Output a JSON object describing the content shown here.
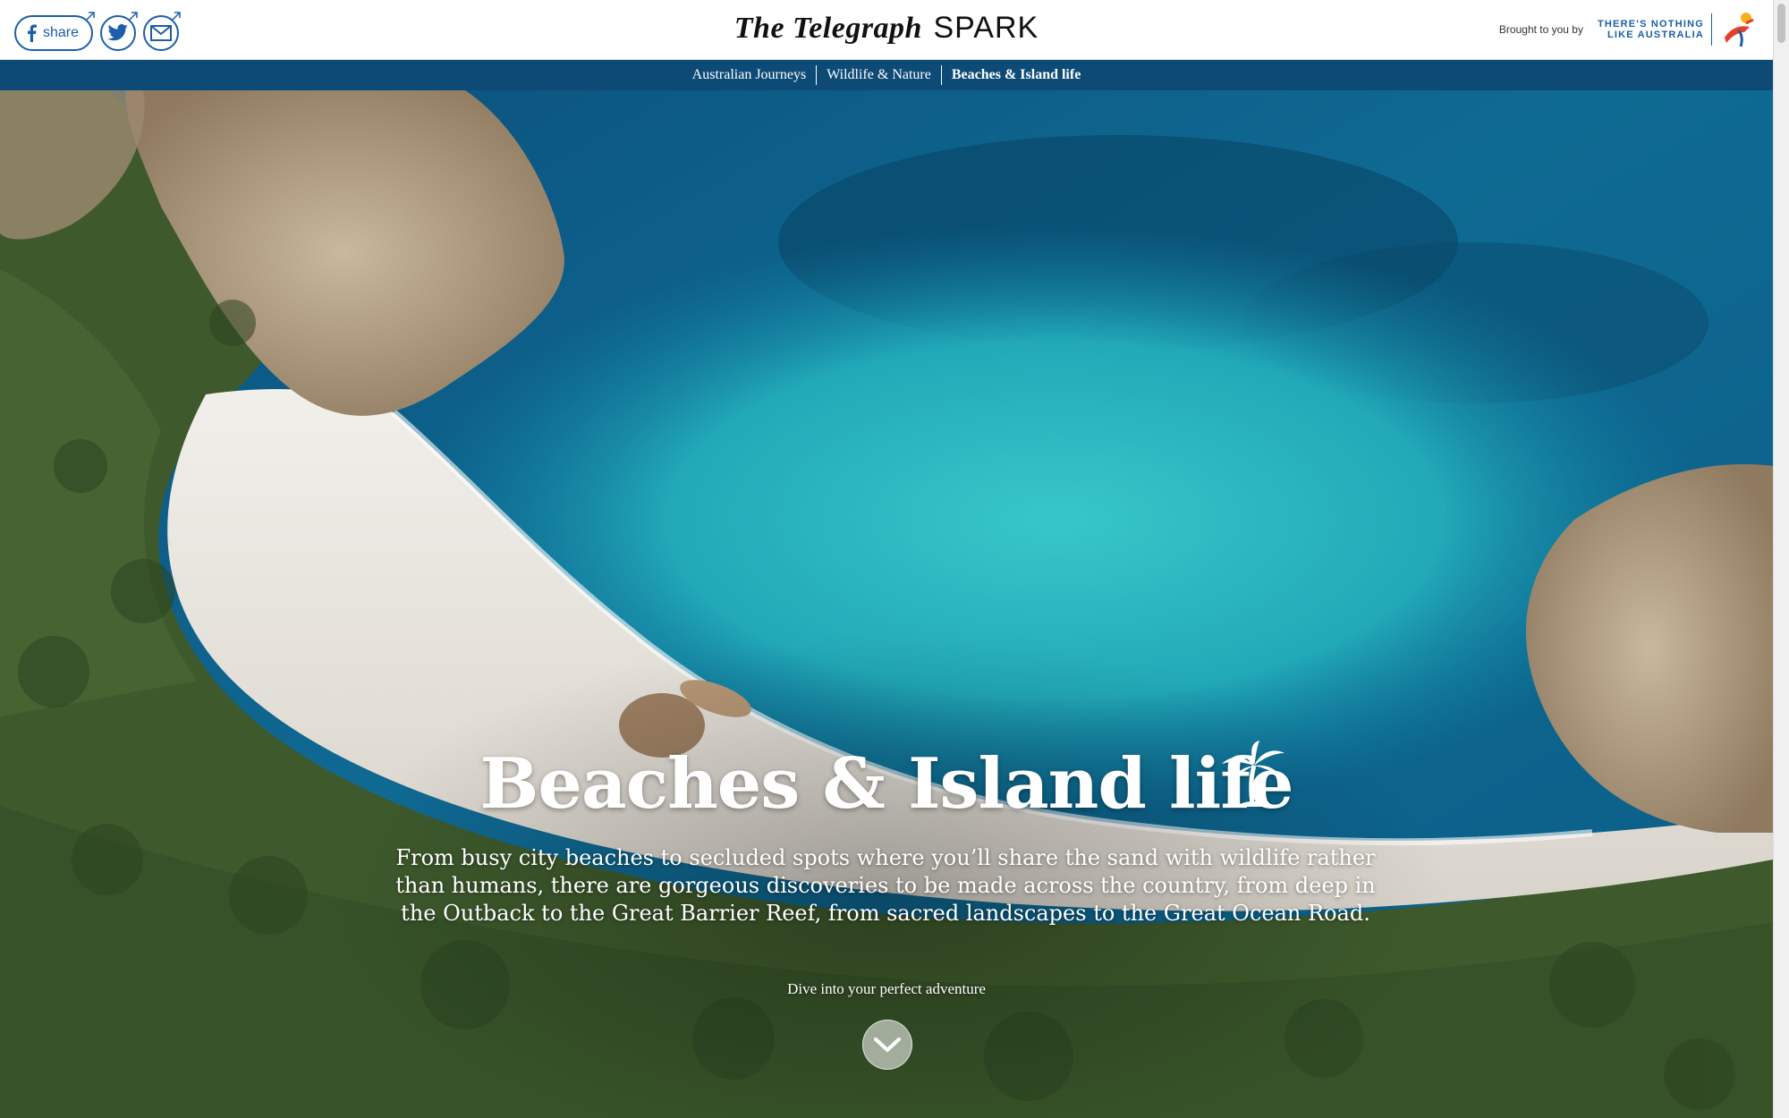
{
  "header": {
    "share_label": "share",
    "brand_primary": "The Telegraph",
    "brand_secondary": "SPARK",
    "sponsor_lead": "Brought to you by",
    "sponsor_line1": "THERE'S NOTHING",
    "sponsor_line2": "LIKE AUSTRALIA"
  },
  "nav": {
    "items": [
      {
        "label": "Australian Journeys"
      },
      {
        "label": "Wildlife & Nature"
      },
      {
        "label": "Beaches & Island life"
      }
    ],
    "active_index": 2
  },
  "hero": {
    "title": "Beaches & Island life",
    "description": "From busy city beaches to secluded spots where you’ll share the sand with wildlife rather than humans, there are gorgeous discoveries to be made across the country, from deep in the Outback to the Great Barrier Reef, from sacred landscapes to the Great Ocean Road.",
    "cta": "Dive into your perfect adventure"
  },
  "icons": {
    "facebook": "facebook-icon",
    "twitter": "twitter-icon",
    "email": "email-icon",
    "palm": "palm-tree-icon",
    "scroll": "chevron-down-icon"
  },
  "colors": {
    "nav_bg": "#0d4a76",
    "social_blue": "#1d5ea8",
    "sea_deep": "#0b5f8a",
    "sea_shallow": "#2fc1c8",
    "sand": "#e9e6e0",
    "bush": "#3e5a2c"
  }
}
